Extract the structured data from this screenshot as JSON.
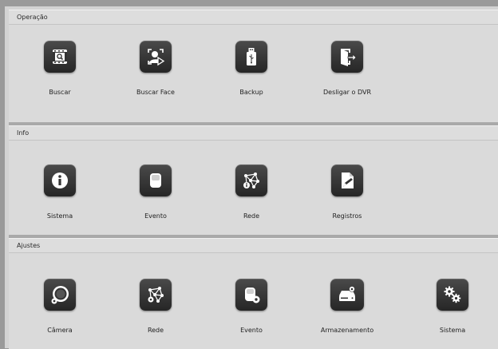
{
  "sections": [
    {
      "title": "Operação",
      "items": [
        {
          "label": "Buscar",
          "icon": "video-search-icon"
        },
        {
          "label": "Buscar Face",
          "icon": "face-search-icon"
        },
        {
          "label": "Backup",
          "icon": "usb-drive-icon"
        },
        {
          "label": "Desligar o DVR",
          "icon": "logout-icon"
        }
      ]
    },
    {
      "title": "Info",
      "items": [
        {
          "label": "Sistema",
          "icon": "info-icon"
        },
        {
          "label": "Evento",
          "icon": "event-sensor-icon"
        },
        {
          "label": "Rede",
          "icon": "network-info-icon"
        },
        {
          "label": "Registros",
          "icon": "log-document-icon"
        }
      ]
    },
    {
      "title": "Ajustes",
      "items": [
        {
          "label": "Câmera",
          "icon": "camera-settings-icon"
        },
        {
          "label": "Rede",
          "icon": "network-settings-icon"
        },
        {
          "label": "Evento",
          "icon": "event-settings-icon"
        },
        {
          "label": "Armazenamento",
          "icon": "storage-settings-icon"
        },
        {
          "label": "Sistema",
          "icon": "system-gears-icon"
        }
      ]
    }
  ],
  "colors": {
    "background": "#d3d3d3",
    "tile": "#333333",
    "icon": "#ffffff"
  }
}
